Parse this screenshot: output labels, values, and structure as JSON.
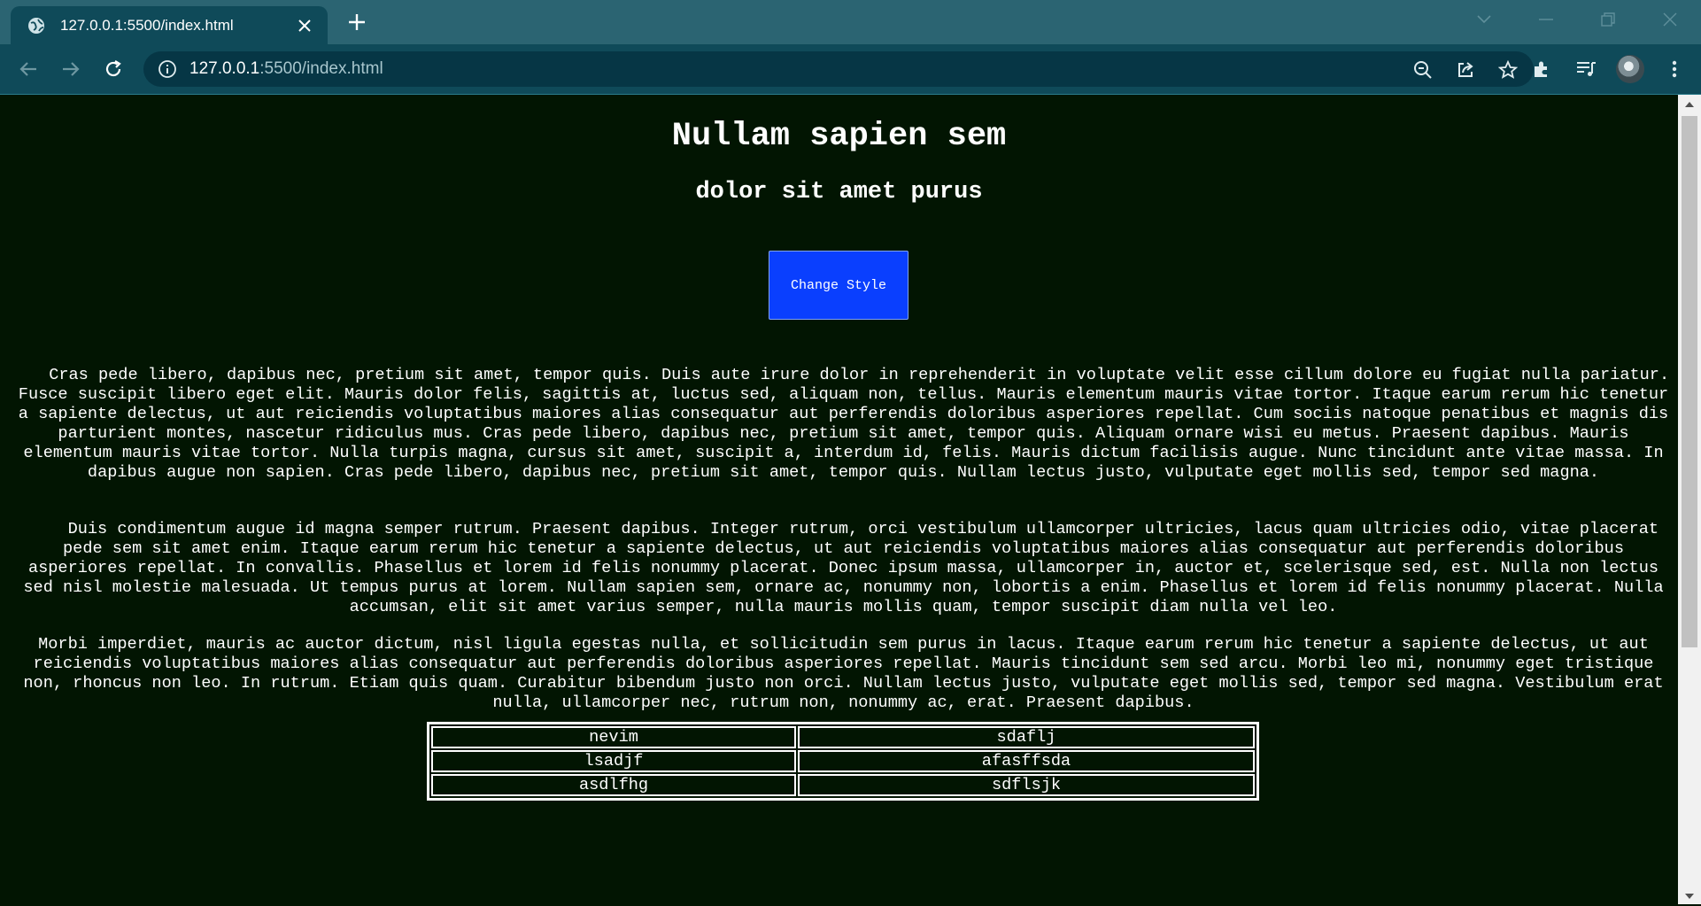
{
  "browser": {
    "tab": {
      "title": "127.0.0.1:5500/index.html",
      "favicon": "globe-icon"
    },
    "address": {
      "host": "127.0.0.1",
      "rest": ":5500/index.html"
    },
    "icons": [
      "back-icon",
      "forward-icon",
      "reload-icon",
      "info-icon",
      "zoom-out-icon",
      "share-icon",
      "star-icon",
      "extensions-icon",
      "media-icon",
      "avatar",
      "menu-icon"
    ]
  },
  "page": {
    "title": "Nullam sapien sem",
    "subtitle": "dolor sit amet purus",
    "button_label": "Change Style",
    "paragraphs": [
      "Cras pede libero, dapibus nec, pretium sit amet, tempor quis. Duis aute irure dolor in reprehenderit in voluptate velit esse cillum dolore eu fugiat nulla pariatur. Fusce suscipit libero eget elit. Mauris dolor felis, sagittis at, luctus sed, aliquam non, tellus. Mauris elementum mauris vitae tortor. Itaque earum rerum hic tenetur a sapiente delectus, ut aut reiciendis voluptatibus maiores alias consequatur aut perferendis doloribus asperiores repellat. Cum sociis natoque penatibus et magnis dis parturient montes, nascetur ridiculus mus. Cras pede libero, dapibus nec, pretium sit amet, tempor quis. Aliquam ornare wisi eu metus. Praesent dapibus. Mauris elementum mauris vitae tortor. Nulla turpis magna, cursus sit amet, suscipit a, interdum id, felis. Mauris dictum facilisis augue. Nunc tincidunt ante vitae massa. In dapibus augue non sapien. Cras pede libero, dapibus nec, pretium sit amet, tempor quis. Nullam lectus justo, vulputate eget mollis sed, tempor sed magna.",
      "Duis condimentum augue id magna semper rutrum. Praesent dapibus. Integer rutrum, orci vestibulum ullamcorper ultricies, lacus quam ultricies odio, vitae placerat pede sem sit amet enim. Itaque earum rerum hic tenetur a sapiente delectus, ut aut reiciendis voluptatibus maiores alias consequatur aut perferendis doloribus asperiores repellat. In convallis. Phasellus et lorem id felis nonummy placerat. Donec ipsum massa, ullamcorper in, auctor et, scelerisque sed, est. Nulla non lectus sed nisl molestie malesuada. Ut tempus purus at lorem. Nullam sapien sem, ornare ac, nonummy non, lobortis a enim. Phasellus et lorem id felis nonummy placerat. Nulla accumsan, elit sit amet varius semper, nulla mauris mollis quam, tempor suscipit diam nulla vel leo.",
      "Morbi imperdiet, mauris ac auctor dictum, nisl ligula egestas nulla, et sollicitudin sem purus in lacus. Itaque earum rerum hic tenetur a sapiente delectus, ut aut reiciendis voluptatibus maiores alias consequatur aut perferendis doloribus asperiores repellat. Mauris tincidunt sem sed arcu. Morbi leo mi, nonummy eget tristique non, rhoncus non leo. In rutrum. Etiam quis quam. Curabitur bibendum justo non orci. Nullam lectus justo, vulputate eget mollis sed, tempor sed magna. Vestibulum erat nulla, ullamcorper nec, rutrum non, nonummy ac, erat. Praesent dapibus."
    ],
    "table": [
      [
        "nevim",
        "sdaflj"
      ],
      [
        "lsadjf",
        "afasffsda"
      ],
      [
        "asdlfhg",
        "sdflsjk"
      ]
    ]
  }
}
